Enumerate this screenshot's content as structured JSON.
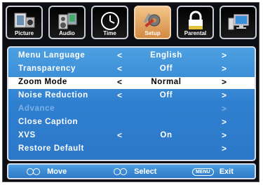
{
  "tabs": [
    {
      "label": "Picture",
      "icon": "picture-icon",
      "active": false
    },
    {
      "label": "Audio",
      "icon": "audio-icon",
      "active": false
    },
    {
      "label": "Time",
      "icon": "clock-icon",
      "active": false
    },
    {
      "label": "Setup",
      "icon": "setup-tools-icon",
      "active": true
    },
    {
      "label": "Parental",
      "icon": "lock-icon",
      "active": false
    },
    {
      "label": "",
      "icon": "computer-icon",
      "active": false
    }
  ],
  "menu": {
    "items": [
      {
        "label": "Menu Language",
        "left": "<",
        "value": "English",
        "right": ">"
      },
      {
        "label": "Transparency",
        "left": "<",
        "value": "Off",
        "right": ">"
      },
      {
        "label": "Zoom Mode",
        "left": "<",
        "value": "Normal",
        "right": ">"
      },
      {
        "label": "Noise Reduction",
        "left": "<",
        "value": "Off",
        "right": ">"
      },
      {
        "label": "Advance",
        "left": "",
        "value": "",
        "right": ">"
      },
      {
        "label": "Close Caption",
        "left": "",
        "value": "",
        "right": ">"
      },
      {
        "label": "XVS",
        "left": "<",
        "value": "On",
        "right": ">"
      },
      {
        "label": "Restore Default",
        "left": "",
        "value": "",
        "right": ">"
      }
    ]
  },
  "footer": {
    "move_label": "Move",
    "select_label": "Select",
    "menu_key": "MENU",
    "exit_label": "Exit"
  }
}
